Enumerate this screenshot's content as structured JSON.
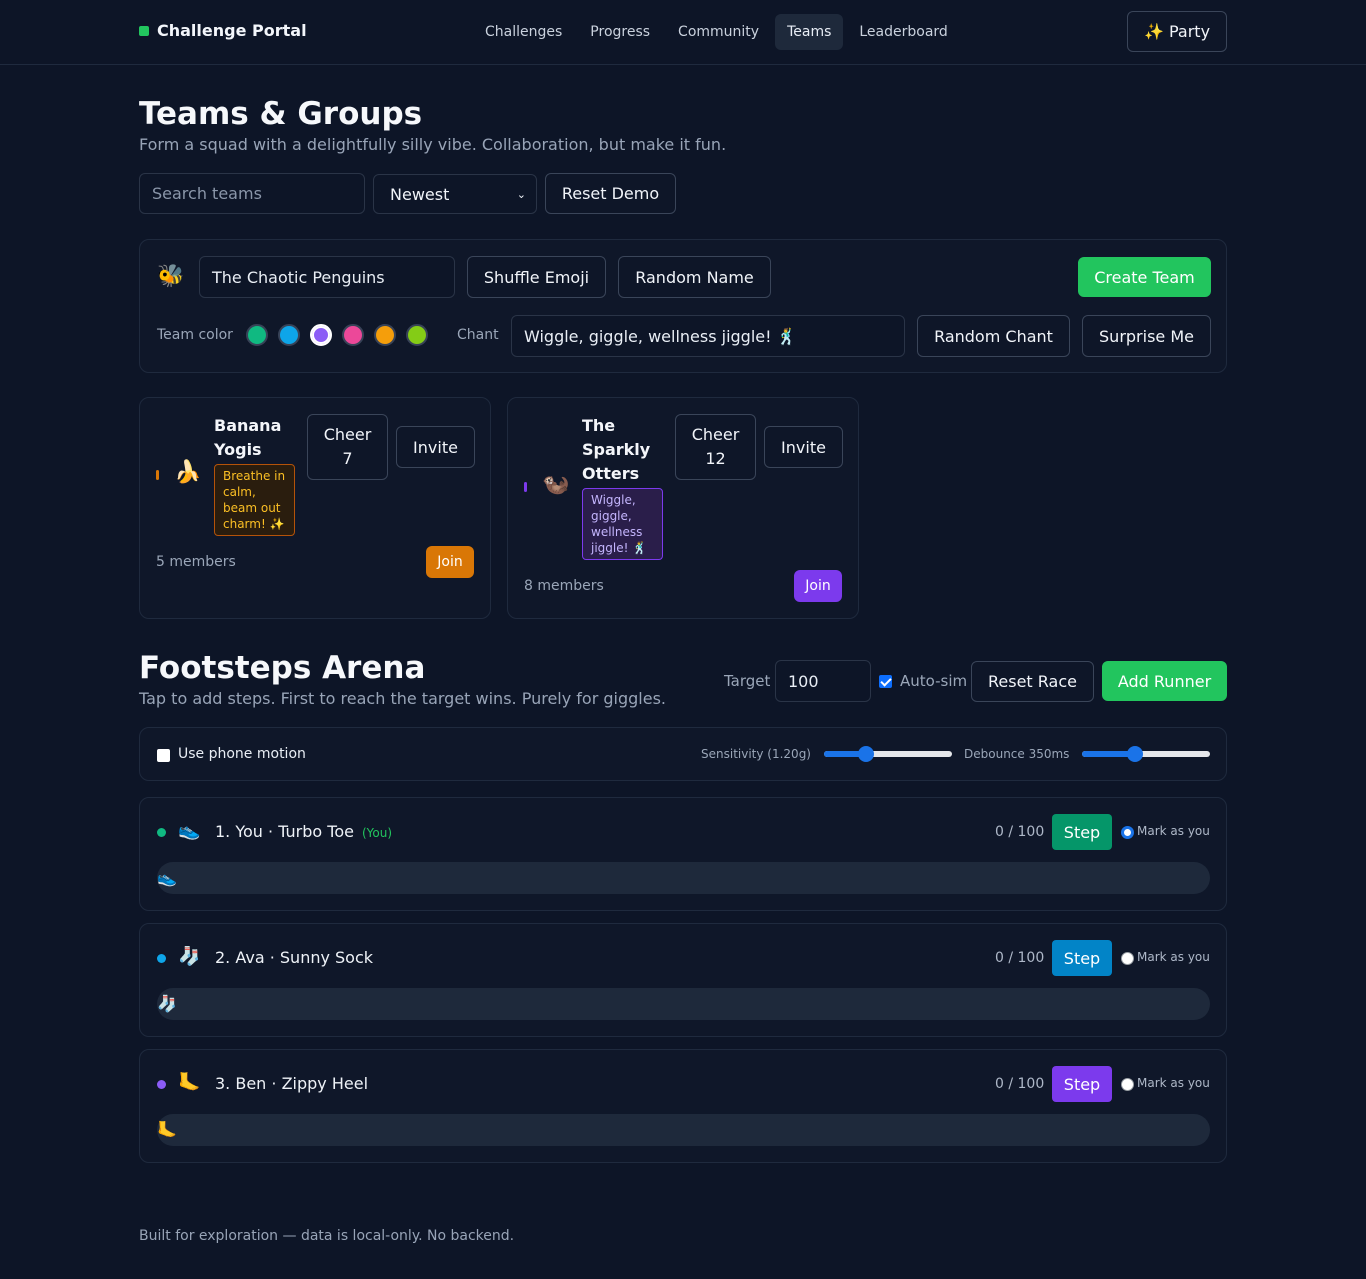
{
  "header": {
    "brand": "Challenge Portal",
    "brand_color": "#22c55e",
    "nav": [
      "Challenges",
      "Progress",
      "Community",
      "Teams",
      "Leaderboard"
    ],
    "active_nav": "Teams",
    "party_label": "✨ Party"
  },
  "teams": {
    "title": "Teams & Groups",
    "subtitle": "Form a squad with a delightfully silly vibe. Collaboration, but make it fun.",
    "search_placeholder": "Search teams",
    "sort_selected": "Newest",
    "reset_label": "Reset Demo"
  },
  "creator": {
    "emoji": "🐝",
    "name_value": "The Chaotic Penguins",
    "shuffle_label": "Shuffle Emoji",
    "random_name_label": "Random Name",
    "create_label": "Create Team",
    "color_label": "Team color",
    "colors": [
      "#10b981",
      "#0ea5e9",
      "#8b5cf6",
      "#ec4899",
      "#f59e0b",
      "#84cc16"
    ],
    "selected_color": "#8b5cf6",
    "chant_label": "Chant",
    "chant_value": "Wiggle, giggle, wellness jiggle! 🕺",
    "random_chant_label": "Random Chant",
    "surprise_label": "Surprise Me"
  },
  "team_cards": [
    {
      "emoji": "🍌",
      "name": "Banana Yogis",
      "chant": "Breathe in calm, beam out charm! ✨",
      "cheer_label": "Cheer",
      "cheer_count": "7",
      "invite_label": "Invite",
      "members": "5 members",
      "join_label": "Join",
      "color": "#d97706"
    },
    {
      "emoji": "🦦",
      "name": "The Sparkly Otters",
      "chant": "Wiggle, giggle, wellness jiggle! 🕺",
      "cheer_label": "Cheer",
      "cheer_count": "12",
      "invite_label": "Invite",
      "members": "8 members",
      "join_label": "Join",
      "color": "#7c3aed"
    }
  ],
  "arena": {
    "title": "Footsteps Arena",
    "subtitle": "Tap to add steps. First to reach the target wins. Purely for giggles.",
    "target_label": "Target",
    "target_value": "100",
    "autosim_label": "Auto-sim",
    "autosim_checked": true,
    "reset_label": "Reset Race",
    "add_label": "Add Runner",
    "motion_label": "Use phone motion",
    "sensitivity_label": "Sensitivity (1.20g)",
    "sensitivity_level": 0.3,
    "debounce_label": "Debounce 350ms",
    "debounce_level": 0.4
  },
  "runners": [
    {
      "dot_color": "#10b981",
      "emoji": "👟",
      "name": "1. You · Turbo Toe",
      "you_tag": "(You)",
      "count": "0 / 100",
      "step_label": "Step",
      "step_color": "#059669",
      "mark_label": "Mark as you",
      "is_you": true,
      "progress": 0
    },
    {
      "dot_color": "#0ea5e9",
      "emoji": "🧦",
      "name": "2. Ava · Sunny Sock",
      "you_tag": "",
      "count": "0 / 100",
      "step_label": "Step",
      "step_color": "#0284c7",
      "mark_label": "Mark as you",
      "is_you": false,
      "progress": 0
    },
    {
      "dot_color": "#8b5cf6",
      "emoji": "🦶",
      "name": "3. Ben · Zippy Heel",
      "you_tag": "",
      "count": "0 / 100",
      "step_label": "Step",
      "step_color": "#7c3aed",
      "mark_label": "Mark as you",
      "is_you": false,
      "progress": 0
    }
  ],
  "footer": "Built for exploration — data is local-only. No backend."
}
